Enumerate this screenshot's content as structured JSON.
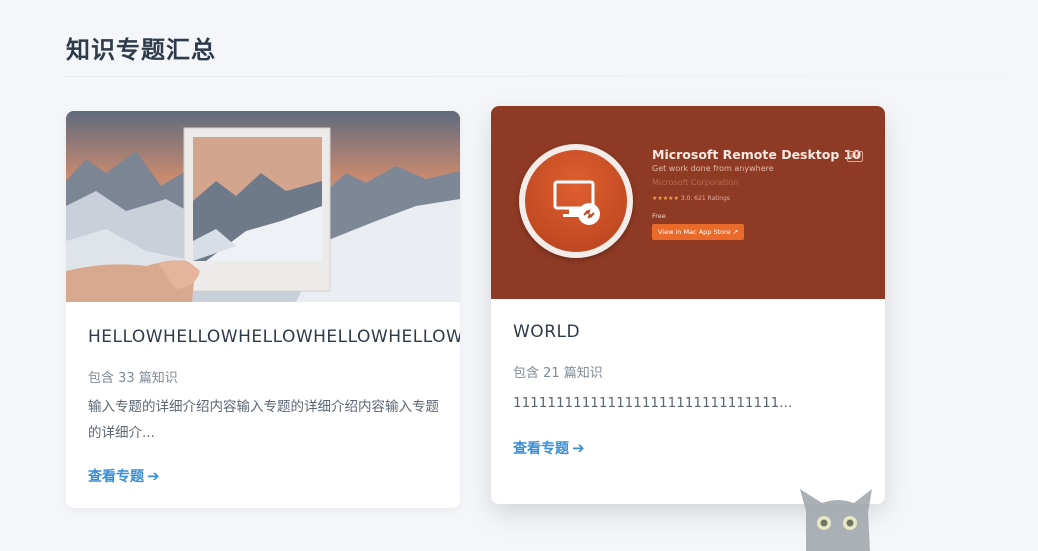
{
  "page": {
    "title": "知识专题汇总"
  },
  "topics": [
    {
      "title": "HELLOWHELLOWHELLOWHELLOWHELLOW",
      "count_text": "包含 33 篇知识",
      "description": "输入专题的详细介绍内容输入专题的详细介绍内容输入专题的详细介...",
      "link_label": "查看专题",
      "link_icon": "arrow-right-icon"
    },
    {
      "title": "WORLD",
      "count_text": "包含 21 篇知识",
      "description": "1111111111111111111111111111111...",
      "link_label": "查看专题",
      "link_icon": "arrow-right-icon",
      "cover": {
        "app_name": "Microsoft Remote Desktop 10",
        "age_badge": "4+",
        "subtitle": "Get work done from anywhere",
        "developer": "Microsoft Corporation",
        "stars": "★★★★★",
        "rating_text": "3.0, 621 Ratings",
        "price": "Free",
        "store_button": "View in Mac App Store ↗"
      }
    }
  ],
  "colors": {
    "accent": "#3a8ed3",
    "title": "#2f3b4a",
    "cover_red": "#8f3a24"
  }
}
